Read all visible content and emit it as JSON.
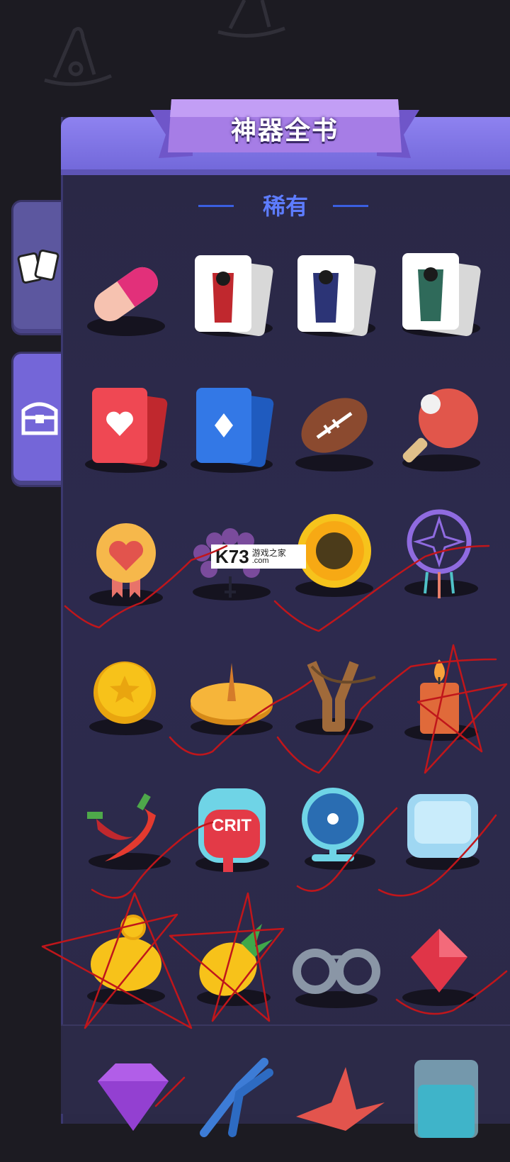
{
  "screen": {
    "title": "神器全书",
    "section_label": "稀有",
    "side_tabs": [
      {
        "name": "cards-tab",
        "icon": "cards-icon"
      },
      {
        "name": "chest-tab",
        "icon": "treasure-chest-icon"
      }
    ],
    "watermark": {
      "logo": "K73",
      "cn": "游戏之家",
      "url": ".com"
    }
  },
  "items": [
    {
      "icon": "pill-capsule-icon"
    },
    {
      "icon": "jack-card-icon"
    },
    {
      "icon": "queen-card-icon"
    },
    {
      "icon": "king-card-icon"
    },
    {
      "icon": "heart-card-icon"
    },
    {
      "icon": "diamond-card-icon"
    },
    {
      "icon": "football-icon"
    },
    {
      "icon": "ping-pong-paddle-icon"
    },
    {
      "icon": "heart-medal-icon"
    },
    {
      "icon": "grape-bracelet-icon"
    },
    {
      "icon": "sunflower-icon"
    },
    {
      "icon": "dreamcatcher-icon"
    },
    {
      "icon": "star-coin-icon"
    },
    {
      "icon": "sundial-icon"
    },
    {
      "icon": "slingshot-icon"
    },
    {
      "icon": "candle-icon"
    },
    {
      "icon": "chili-peppers-icon"
    },
    {
      "icon": "crit-blood-bag-icon",
      "label": "CRIT"
    },
    {
      "icon": "electric-fan-icon"
    },
    {
      "icon": "ice-cube-icon"
    },
    {
      "icon": "piggy-bank-icon"
    },
    {
      "icon": "pineapple-icon"
    },
    {
      "icon": "handcuffs-icon"
    },
    {
      "icon": "red-gem-icon"
    },
    {
      "icon": "purple-diamond-icon"
    },
    {
      "icon": "pliers-icon"
    },
    {
      "icon": "paper-crane-icon"
    },
    {
      "icon": "glass-of-water-icon"
    }
  ],
  "colors": {
    "background": "#1c1b22",
    "panel": "#2b2947",
    "header": "#7a6fe2",
    "section_label": "#5d7cff",
    "scribble": "#c0161b"
  }
}
